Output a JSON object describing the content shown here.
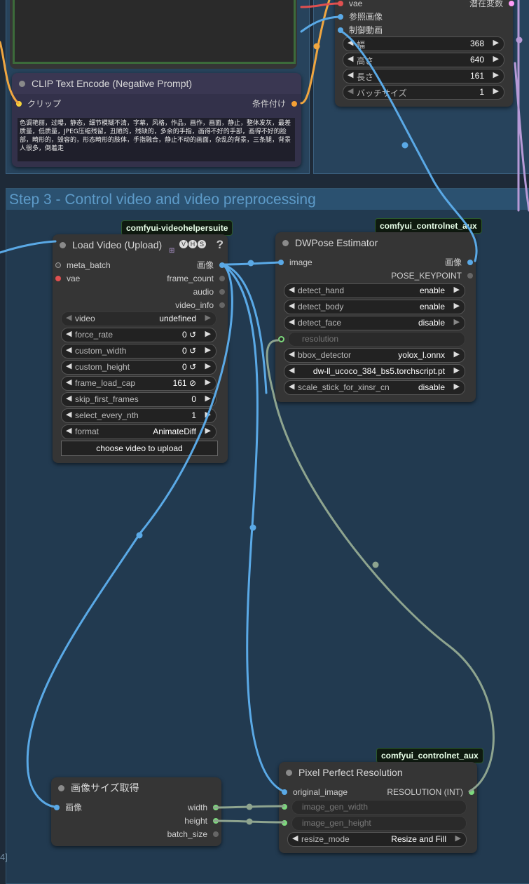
{
  "colors": {
    "wire_blue": "#5aa9e6",
    "wire_gray": "#8ea48f",
    "wire_orange": "#f0a640",
    "wire_purple": "#b79ad6",
    "wire_red": "#e05050",
    "canvas": "#1e2a38",
    "node": "#353535"
  },
  "top_right_node": {
    "inputs": [
      "vae",
      "参照画像",
      "制御動画"
    ],
    "output": "潜在変数",
    "widgets": [
      {
        "label": "幅",
        "value": "368"
      },
      {
        "label": "高さ",
        "value": "640"
      },
      {
        "label": "長さ",
        "value": "161"
      },
      {
        "label": "バッチサイズ",
        "value": "1"
      }
    ]
  },
  "clip_node": {
    "title": "CLIP Text Encode (Negative Prompt)",
    "input": "クリップ",
    "output": "条件付け",
    "text": "色调艳丽，过曝，静态，细节模糊不清，字幕，风格，作品，画作，画面，静止，整体发灰，最差质量，低质量，JPEG压缩残留，丑陋的，残缺的，多余的手指，画得不好的手部，画得不好的脸部，畸形的，毁容的，形态畸形的肢体，手指融合，静止不动的画面，杂乱的背景，三条腿，背景人很多，倒着走"
  },
  "group_step3": {
    "title": "Step 3 - Control video and video preprocessing"
  },
  "load_video": {
    "badge": "comfyui-videohelpersuite",
    "title": "Load Video (Upload)",
    "help": "?",
    "icons": [
      "V",
      "H",
      "S"
    ],
    "inputs": [
      "meta_batch",
      "vae"
    ],
    "outputs": [
      "画像",
      "frame_count",
      "audio",
      "video_info"
    ],
    "widgets": [
      {
        "label": "video",
        "value": "undefined"
      },
      {
        "label": "force_rate",
        "value": "0 ↺"
      },
      {
        "label": "custom_width",
        "value": "0 ↺"
      },
      {
        "label": "custom_height",
        "value": "0 ↺"
      },
      {
        "label": "frame_load_cap",
        "value": "161 ⊘"
      },
      {
        "label": "skip_first_frames",
        "value": "0"
      },
      {
        "label": "select_every_nth",
        "value": "1"
      },
      {
        "label": "format",
        "value": "AnimateDiff"
      }
    ],
    "upload_button": "choose video to upload"
  },
  "dwpose": {
    "badge": "comfyui_controlnet_aux",
    "title": "DWPose Estimator",
    "input": "image",
    "outputs": [
      "画像",
      "POSE_KEYPOINT"
    ],
    "widgets": [
      {
        "label": "detect_hand",
        "value": "enable"
      },
      {
        "label": "detect_body",
        "value": "enable"
      },
      {
        "label": "detect_face",
        "value": "disable"
      },
      {
        "label": "resolution",
        "value": ""
      },
      {
        "label": "bbox_detector",
        "value": "yolox_l.onnx"
      },
      {
        "label": "",
        "value": "dw-ll_ucoco_384_bs5.torchscript.pt"
      },
      {
        "label": "scale_stick_for_xinsr_cn",
        "value": "disable"
      }
    ]
  },
  "image_size": {
    "title": "画像サイズ取得",
    "input": "画像",
    "outputs": [
      "width",
      "height",
      "batch_size"
    ]
  },
  "pixel_perfect": {
    "badge": "comfyui_controlnet_aux",
    "title": "Pixel Perfect Resolution",
    "input": "original_image",
    "output": "RESOLUTION (INT)",
    "widget_inputs": [
      "image_gen_width",
      "image_gen_height"
    ],
    "widget": {
      "label": "resize_mode",
      "value": "Resize and Fill"
    }
  },
  "edge_text": {
    "bottom_left": "4]"
  }
}
